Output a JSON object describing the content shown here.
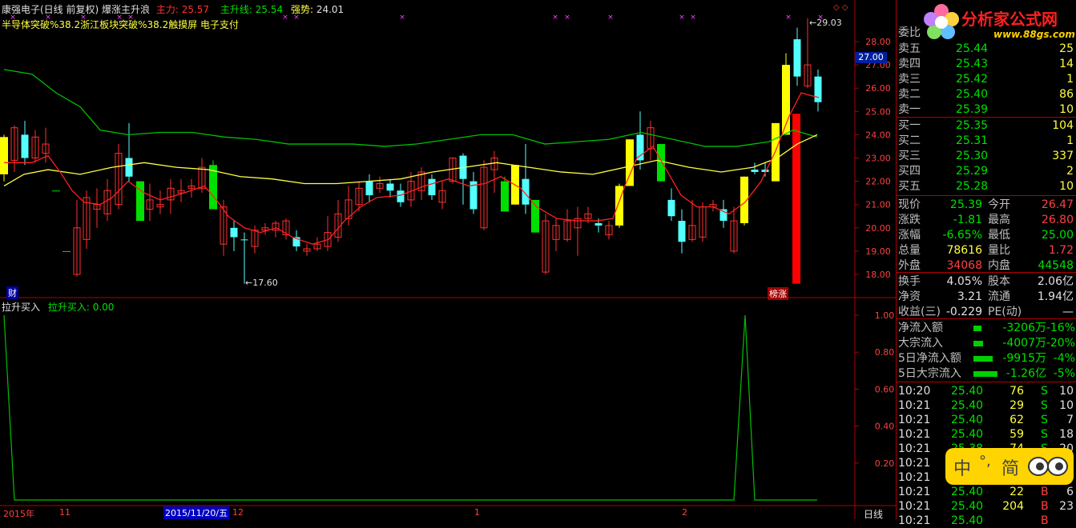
{
  "header": {
    "title": "康强电子(日线 前复权) 爆涨主升浪",
    "zhuli_label": "主力:",
    "zhuli_value": "25.57",
    "zhushengxian_label": "主升线:",
    "zhushengxian_value": "25.54",
    "qiangshi_label": "强势:",
    "qiangshi_value": "24.01",
    "concepts": "半导体突破%38.2浙江板块突破%38.2触摸屏 电子支付"
  },
  "main_chart": {
    "y_ticks": [
      "28.00",
      "27.00",
      "26.00",
      "25.00",
      "24.00",
      "23.00",
      "22.00",
      "21.00",
      "20.00",
      "19.00",
      "18.00"
    ],
    "y_tick_values": [
      28,
      27,
      26,
      25,
      24,
      23,
      22,
      21,
      20,
      19,
      18
    ],
    "current_price_tag": "27.00",
    "high_label": "29.03",
    "low_label": "17.60",
    "cai_badge": "财",
    "bang_badge": "榜涨",
    "colors": {
      "up": "#ff3030",
      "down": "#54ffff",
      "yellow_bar": "#ffff00",
      "green_bar": "#00e000",
      "red_bar": "#ff0000",
      "ma_short": "#ff2020",
      "ma_mid": "#ffff40",
      "ma_long": "#00c000"
    }
  },
  "sub_chart": {
    "title": "拉升买入",
    "value_label": "拉升买入: 0.00",
    "y_ticks": [
      "1.00",
      "0.80",
      "0.60",
      "0.40",
      "0.20"
    ],
    "y_tick_values": [
      1.0,
      0.8,
      0.6,
      0.4,
      0.2
    ]
  },
  "x_axis": {
    "year": "2015年",
    "m11": "11",
    "date_cursor": "2015/11/20/五",
    "m12": "12",
    "m1": "1",
    "m2": "2",
    "period": "日线"
  },
  "logo": {
    "text": "分析家公式网",
    "url_text": "www.88gs.com"
  },
  "orderbook": {
    "weibi_label": "委比",
    "asks": [
      {
        "label": "卖五",
        "price": "25.44",
        "vol": "25"
      },
      {
        "label": "卖四",
        "price": "25.43",
        "vol": "14"
      },
      {
        "label": "卖三",
        "price": "25.42",
        "vol": "1"
      },
      {
        "label": "卖二",
        "price": "25.40",
        "vol": "86"
      },
      {
        "label": "卖一",
        "price": "25.39",
        "vol": "10"
      }
    ],
    "bids": [
      {
        "label": "买一",
        "price": "25.35",
        "vol": "104"
      },
      {
        "label": "买二",
        "price": "25.31",
        "vol": "1"
      },
      {
        "label": "买三",
        "price": "25.30",
        "vol": "337"
      },
      {
        "label": "买四",
        "price": "25.29",
        "vol": "2"
      },
      {
        "label": "买五",
        "price": "25.28",
        "vol": "10"
      }
    ]
  },
  "quote": [
    {
      "l1": "现价",
      "v1": "25.39",
      "c1": "green",
      "l2": "今开",
      "v2": "26.47",
      "c2": "red"
    },
    {
      "l1": "涨跌",
      "v1": "-1.81",
      "c1": "green",
      "l2": "最高",
      "v2": "26.80",
      "c2": "red"
    },
    {
      "l1": "涨幅",
      "v1": "-6.65%",
      "c1": "green",
      "l2": "最低",
      "v2": "25.00",
      "c2": "green"
    },
    {
      "l1": "总量",
      "v1": "78616",
      "c1": "yellow",
      "l2": "量比",
      "v2": "1.72",
      "c2": "red"
    },
    {
      "l1": "外盘",
      "v1": "34068",
      "c1": "red",
      "l2": "内盘",
      "v2": "44548",
      "c2": "green"
    }
  ],
  "fundamentals": [
    {
      "l1": "换手",
      "v1": "4.05%",
      "l2": "股本",
      "v2": "2.06亿"
    },
    {
      "l1": "净资",
      "v1": "3.21",
      "l2": "流通",
      "v2": "1.94亿"
    },
    {
      "l1": "收益(三)",
      "v1": "-0.229",
      "l2": "PE(动)",
      "v2": "—"
    }
  ],
  "flows": [
    {
      "label": "净流入额",
      "value": "-3206万",
      "pct": "-16%",
      "bar": 0.16
    },
    {
      "label": "大宗流入",
      "value": "-4007万",
      "pct": "-20%",
      "bar": 0.2
    },
    {
      "label": "5日净流入额",
      "value": "-9915万",
      "pct": "-4%",
      "bar": 0.4
    },
    {
      "label": "5日大宗流入",
      "value": "-1.26亿",
      "pct": "-5%",
      "bar": 0.5
    }
  ],
  "ticks": [
    {
      "time": "10:20",
      "price": "25.40",
      "vol": "76",
      "side": "S",
      "n": "10"
    },
    {
      "time": "10:21",
      "price": "25.40",
      "vol": "29",
      "side": "S",
      "n": "10"
    },
    {
      "time": "10:21",
      "price": "25.40",
      "vol": "62",
      "side": "S",
      "n": "7"
    },
    {
      "time": "10:21",
      "price": "25.40",
      "vol": "59",
      "side": "S",
      "n": "18"
    },
    {
      "time": "10:21",
      "price": "25.38",
      "vol": "74",
      "side": "S",
      "n": "20"
    },
    {
      "time": "10:21",
      "price": "",
      "vol": "",
      "side": "",
      "n": ""
    },
    {
      "time": "10:21",
      "price": "",
      "vol": "",
      "side": "",
      "n": ""
    },
    {
      "time": "10:21",
      "price": "25.40",
      "vol": "22",
      "side": "B",
      "n": "6"
    },
    {
      "time": "10:21",
      "price": "25.40",
      "vol": "204",
      "side": "B",
      "n": "23"
    },
    {
      "time": "10:21",
      "price": "25.40",
      "vol": "",
      "side": "B",
      "n": ""
    }
  ],
  "ime": {
    "char1": "中",
    "char2": "°,",
    "char3": "简"
  }
}
